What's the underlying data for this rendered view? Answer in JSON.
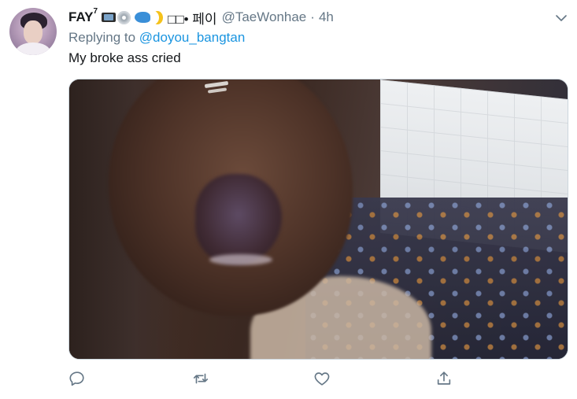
{
  "tweet": {
    "display_name": "FAY",
    "display_name_sup": "7",
    "korean_name": "□□• 페이",
    "handle": "@TaeWonhae",
    "separator": "·",
    "time": "4h",
    "reply_prefix": "Replying to",
    "reply_to": "@doyou_bangtan",
    "text": "My broke ass cried"
  },
  "emoji_icons": [
    "tv-icon",
    "disc-icon",
    "whale-icon",
    "moon-icon"
  ],
  "colors": {
    "link": "#1b95e0",
    "muted": "#657786",
    "text": "#14171a"
  }
}
